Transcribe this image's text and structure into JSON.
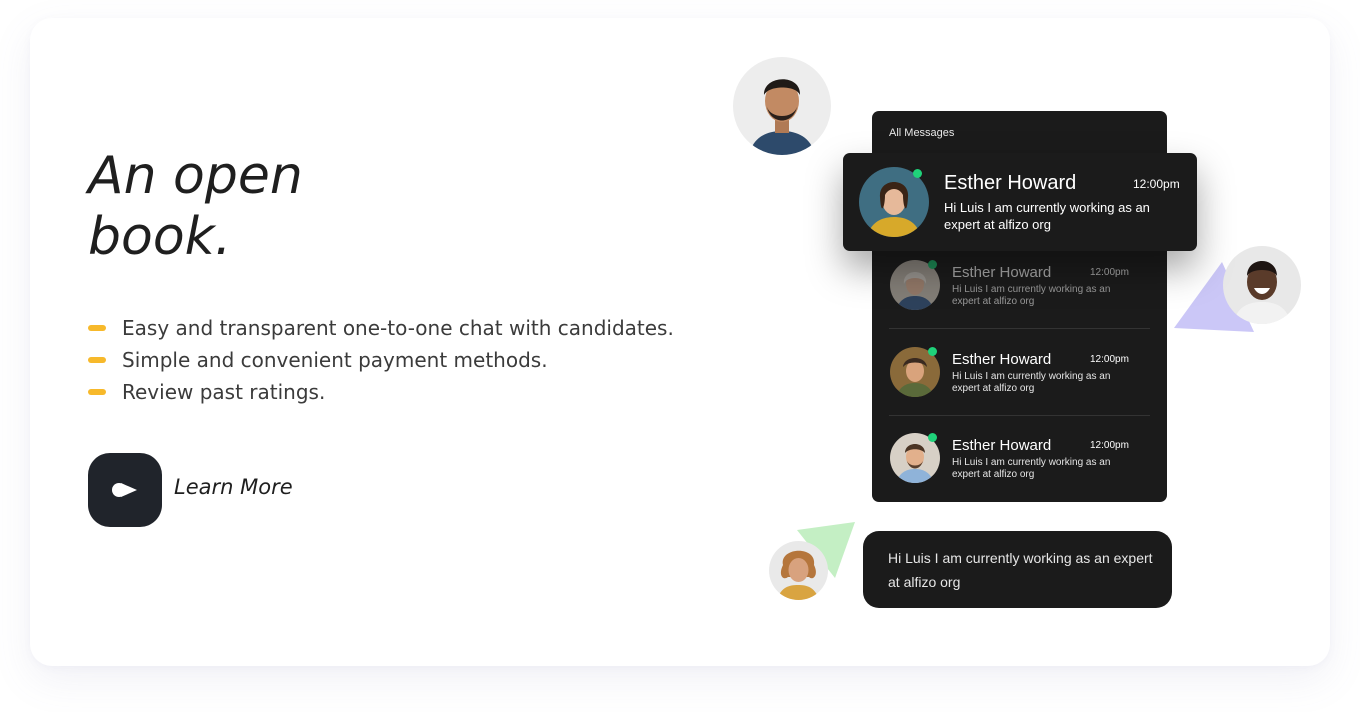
{
  "hero": {
    "headline_line1": "An open",
    "headline_line2": "book.",
    "features": [
      "Easy and transparent one-to-one chat with candidates.",
      "Simple and convenient payment methods.",
      "Review past ratings."
    ],
    "learn_more_label": "Learn More"
  },
  "chat": {
    "panel_title": "All Messages",
    "highlighted": {
      "name": "Esther Howard",
      "time": "12:00pm",
      "message": "Hi Luis I am currently working as an expert at alfizo org"
    },
    "rows": [
      {
        "name": "Esther Howard",
        "time": "12:00pm",
        "message": "Hi Luis I am currently working as an expert at alfizo org",
        "dimmed": true
      },
      {
        "name": "Esther Howard",
        "time": "12:00pm",
        "message": "Hi Luis I am currently working as an expert at alfizo org",
        "dimmed": false
      },
      {
        "name": "Esther Howard",
        "time": "12:00pm",
        "message": "Hi Luis I am currently working as an expert at alfizo org",
        "dimmed": false
      }
    ],
    "bubble_message": "Hi Luis I am currently working as an expert at alfizo org"
  },
  "colors": {
    "accent_dash": "#f7b92b",
    "panel_bg": "#1b1b1b",
    "online_dot": "#1fd27a",
    "triangle_purple": "#cbc7f7",
    "triangle_green": "#c4efc4"
  },
  "icons": {
    "learn_more": "play-arrow-icon"
  }
}
